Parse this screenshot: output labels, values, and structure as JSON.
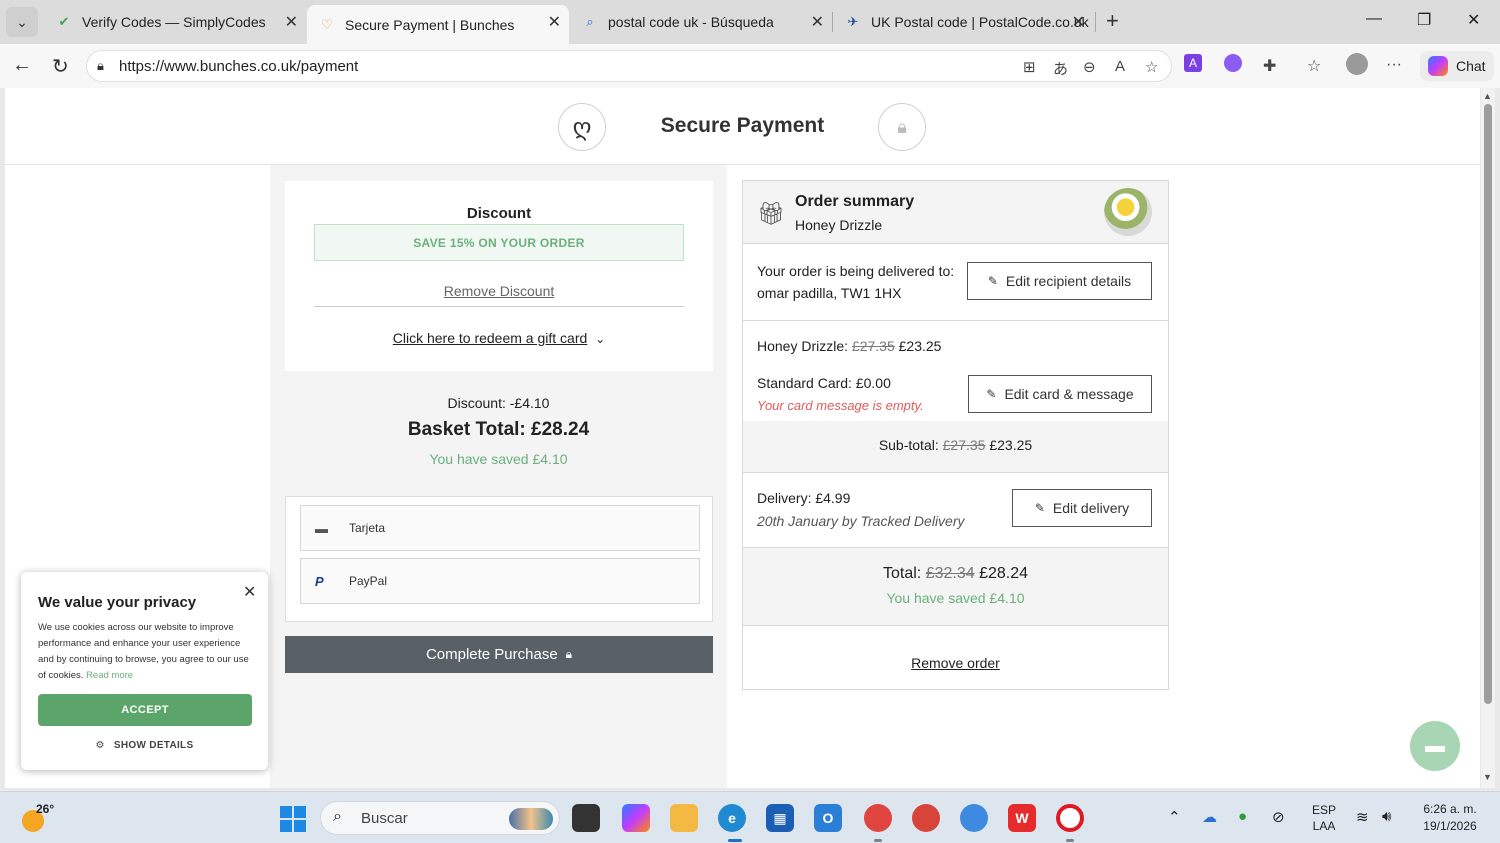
{
  "browser": {
    "tabs": [
      {
        "title": "Verify Codes — SimplyCodes",
        "favicon": "simplycodes-icon"
      },
      {
        "title": "Secure Payment | Bunches",
        "favicon": "bunches-icon",
        "active": true
      },
      {
        "title": "postal code uk - Búsqueda",
        "favicon": "search-icon"
      },
      {
        "title": "UK Postal code | PostalCode.co.uk",
        "favicon": "postalcode-icon"
      }
    ],
    "url": "https://www.bunches.co.uk/payment",
    "chat_label": "Chat"
  },
  "header": {
    "title": "Secure Payment"
  },
  "discount": {
    "title": "Discount",
    "code_banner": "SAVE 15% ON YOUR ORDER",
    "remove_label": "Remove Discount",
    "gift_card_link": "Click here to redeem a gift card"
  },
  "totals": {
    "discount_line": "Discount: -£4.10",
    "basket_total": "Basket Total: £28.24",
    "saved": "You have saved £4.10"
  },
  "payment": {
    "options": [
      {
        "label": "Tarjeta",
        "icon": "card-icon"
      },
      {
        "label": "PayPal",
        "icon": "paypal-icon"
      }
    ],
    "complete_label": "Complete Purchase"
  },
  "summary": {
    "title": "Order summary",
    "product": "Honey Drizzle",
    "delivery_to_label": "Your order is being delivered to:",
    "recipient": "omar padilla, TW1 1HX",
    "edit_recipient": "Edit recipient details",
    "item_label": "Honey Drizzle:",
    "item_old_price": "£27.35",
    "item_price": "£23.25",
    "card_line": "Standard Card: £0.00",
    "card_note": "Your card message is empty.",
    "edit_card": "Edit card & message",
    "subtotal_label": "Sub-total:",
    "subtotal_old": "£27.35",
    "subtotal": "£23.25",
    "delivery_line": "Delivery: £4.99",
    "delivery_date": "20th January by Tracked Delivery",
    "edit_delivery": "Edit delivery",
    "total_label": "Total:",
    "total_old": "£32.34",
    "total": "£28.24",
    "total_saved": "You have saved £4.10",
    "remove_order": "Remove order"
  },
  "cookie": {
    "title": "We value your privacy",
    "text": "We use cookies across our website to improve performance and enhance your user experience and by continuing to browse, you agree to our use of cookies.",
    "read_more": "Read more",
    "accept": "ACCEPT",
    "show_details": "SHOW DETAILS"
  },
  "taskbar": {
    "temperature": "26°",
    "search_placeholder": "Buscar",
    "lang_1": "ESP",
    "lang_2": "LAA",
    "time": "6:26 a. m.",
    "date": "19/1/2026"
  }
}
